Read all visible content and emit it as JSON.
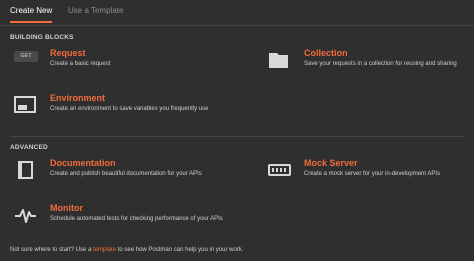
{
  "tabs": {
    "create_new": "Create New",
    "use_template": "Use a Template"
  },
  "sections": {
    "building_blocks": "BUILDING BLOCKS",
    "advanced": "ADVANCED"
  },
  "request": {
    "badge": "GET",
    "title": "Request",
    "desc": "Create a basic request"
  },
  "collection": {
    "title": "Collection",
    "desc": "Save your requests in a collection for reusing and sharing"
  },
  "environment": {
    "title": "Environment",
    "desc": "Create an environment to save variables you frequently use"
  },
  "documentation": {
    "title": "Documentation",
    "desc": "Create and publish beautiful documentation for your APIs"
  },
  "mock_server": {
    "title": "Mock Server",
    "desc": "Create a mock server for your in-development APIs"
  },
  "monitor": {
    "title": "Monitor",
    "desc": "Schedule automated tests for checking performance of your APIs"
  },
  "footer": {
    "prefix": "Not sure where to start? Use a",
    "link": "template",
    "suffix": "to see how Postman can help you in your work."
  },
  "colors": {
    "accent": "#f26b3a",
    "background": "#2f2f2f"
  },
  "icons": {
    "collection": "folder-icon",
    "environment": "environment-icon",
    "documentation": "book-icon",
    "mock_server": "server-icon",
    "monitor": "pulse-icon"
  }
}
